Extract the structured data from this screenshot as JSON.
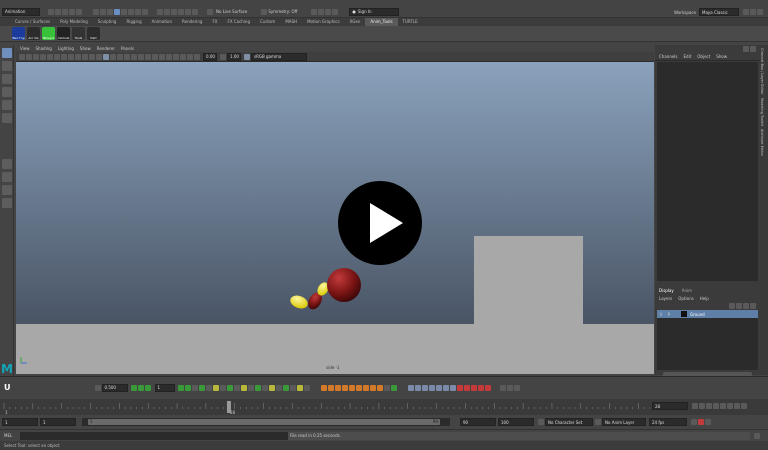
{
  "statusline": {
    "mode": "Animation",
    "live_surface": "No Live Surface",
    "symmetry": "Symmetry: Off",
    "sign_in": "Sign In",
    "workspace_label": "Workspace",
    "workspace_value": "Maya Classic"
  },
  "shelf_tabs": [
    "Curves / Surfaces",
    "Poly Modeling",
    "Sculpting",
    "Rigging",
    "Animation",
    "Rendering",
    "FX",
    "FX Caching",
    "Custom",
    "MASH",
    "Motion Graphics",
    "XGen",
    "Anim_Tools",
    "TURTLE"
  ],
  "shelf_active": "Anim_Tools",
  "shelf_buttons": [
    {
      "label": "Bez Tng",
      "color": "#1b3c9c"
    },
    {
      "label": "Arc Vis",
      "color": "#2c2c2c"
    },
    {
      "label": "Mbleprs",
      "color": "#38c23a"
    },
    {
      "label": "mGhost",
      "color": "#222"
    },
    {
      "label": "Tools",
      "color": "#333"
    },
    {
      "label": "ltaD",
      "color": "#2d2d2d"
    }
  ],
  "viewport_menu": [
    "View",
    "Shading",
    "Lighting",
    "Show",
    "Renderer",
    "Panels"
  ],
  "viewport_toolbar": {
    "exposure": "0.00",
    "gamma": "1.00",
    "color_space": "sRGB gamma"
  },
  "viewport": {
    "camera_label": "side -1",
    "play_icon": "play-icon"
  },
  "channel_box": {
    "menu": [
      "Channels",
      "Edit",
      "Object",
      "Show"
    ]
  },
  "layer_editor": {
    "tabs": [
      "Display",
      "Anim"
    ],
    "menu": [
      "Layers",
      "Options",
      "Help"
    ],
    "layer_v": "V",
    "layer_p": "P",
    "layer_name": "Ground"
  },
  "side_tabs": [
    "Channel Box / Layer Editor",
    "Modeling Toolkit",
    "Attribute Editor"
  ],
  "anim_toolbar": {
    "value_field": "0.500",
    "frame_field": "1"
  },
  "timeline": {
    "ticks": [
      "1",
      "",
      "",
      "",
      "",
      "",
      "",
      "",
      "",
      "",
      "",
      "",
      "",
      "",
      "",
      "",
      "",
      "",
      "",
      "",
      "",
      "",
      "",
      "",
      "",
      "",
      "",
      "",
      "",
      "",
      "",
      "",
      "",
      "",
      "",
      "",
      "",
      "",
      "",
      "28",
      "",
      "",
      "",
      "",
      "",
      "",
      "",
      "",
      "",
      "",
      "",
      "",
      "",
      "",
      "",
      "",
      "",
      "",
      "",
      "",
      "",
      "",
      "",
      "",
      "",
      "",
      "",
      "",
      "",
      "",
      "",
      "",
      "",
      "",
      "",
      "",
      "",
      "",
      "",
      "",
      "",
      "",
      "",
      "",
      "",
      "",
      "",
      "",
      "",
      "",
      "",
      "",
      "",
      "",
      "",
      "",
      "",
      "",
      "",
      "",
      "",
      "",
      "",
      "",
      "",
      "",
      "",
      "",
      "",
      "",
      "",
      "",
      ""
    ],
    "current_frame": "28"
  },
  "range": {
    "start": "1",
    "start2": "1",
    "slider_start": "1",
    "slider_end": "90",
    "end": "90",
    "end2": "100",
    "character_set": "No Character Set",
    "anim_layer": "No Anim Layer",
    "fps": "24 fps"
  },
  "command_line": {
    "label": "MEL",
    "result": "File read in  0.25 seconds."
  },
  "help_line": "Select Tool: select an object"
}
